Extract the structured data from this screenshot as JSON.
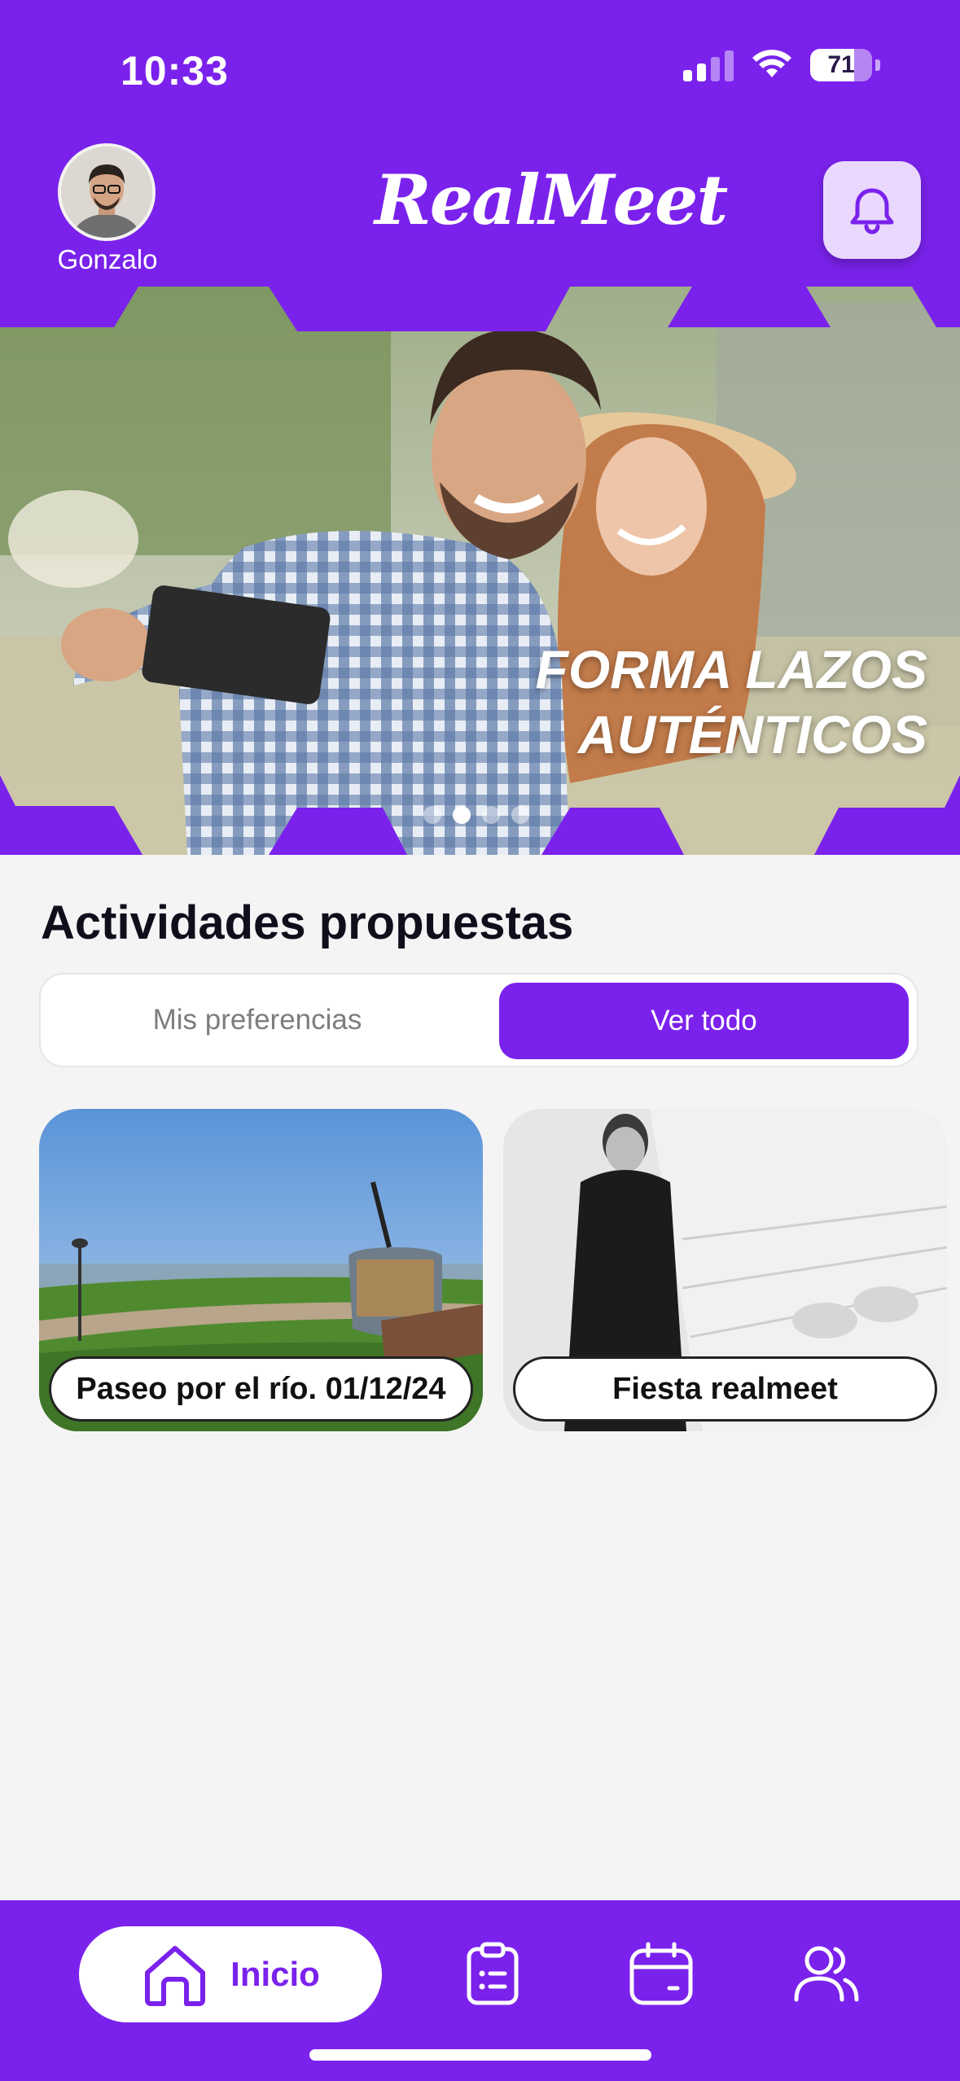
{
  "status_bar": {
    "time": "10:33",
    "battery": "71"
  },
  "header": {
    "user_name": "Gonzalo",
    "logo": "RealMeet"
  },
  "hero": {
    "line1": "FORMA LAZOS",
    "line2": "AUTÉNTICOS"
  },
  "section": {
    "title": "Actividades propuestas"
  },
  "segment": {
    "left": "Mis preferencias",
    "right": "Ver todo"
  },
  "cards": [
    {
      "label": "Paseo por el río. 01/12/24"
    },
    {
      "label": "Fiesta realmeet"
    }
  ],
  "nav": {
    "home_label": "Inicio"
  },
  "colors": {
    "primary": "#7a22ec",
    "bell_bg": "#ead8ff",
    "background": "#f4f4f4"
  }
}
